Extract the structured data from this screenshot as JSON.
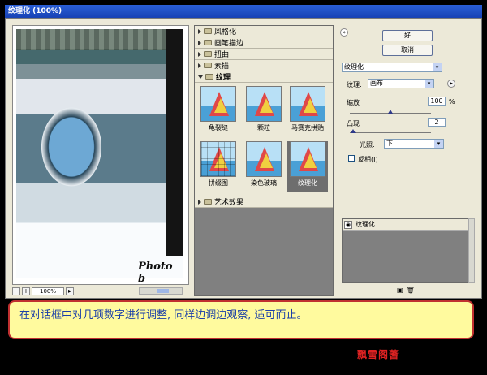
{
  "window": {
    "title": "纹理化 (100%)"
  },
  "preview": {
    "zoom": "100%",
    "zoom_minus": "−",
    "zoom_plus": "+",
    "signature": "Photo b"
  },
  "filters": {
    "categories": [
      "风格化",
      "画笔描边",
      "扭曲",
      "素描"
    ],
    "open_category": "纹理",
    "thumbs": [
      "龟裂缝",
      "颗粒",
      "马赛克拼贴",
      "拼缀图",
      "染色玻璃",
      "纹理化"
    ],
    "after_category": "艺术效果",
    "selected": "纹理化"
  },
  "controls": {
    "ok": "好",
    "cancel": "取消",
    "filter_select": "纹理化",
    "texture_label": "纹理:",
    "texture_value": "画布",
    "scaling_label": "缩放",
    "scaling_value": "100",
    "scaling_unit": "%",
    "scaling_level": 0.5,
    "relief_label": "凸现",
    "relief_value": "2",
    "relief_level": 0.04,
    "light_label": "光照:",
    "light_value": "下",
    "invert_label": "反相(I)",
    "invert_checked": false
  },
  "layers": {
    "items": [
      "纹理化"
    ]
  },
  "caption": "在对话框中对几项数字进行调整, 同样边调边观察, 适可而止。",
  "stamp": "飘雪阁蓍",
  "colors": {
    "title_bar": "#2a5fd6",
    "caption_bg": "#fffa9e",
    "caption_border": "#c03030",
    "caption_text": "#1b3fa8"
  }
}
